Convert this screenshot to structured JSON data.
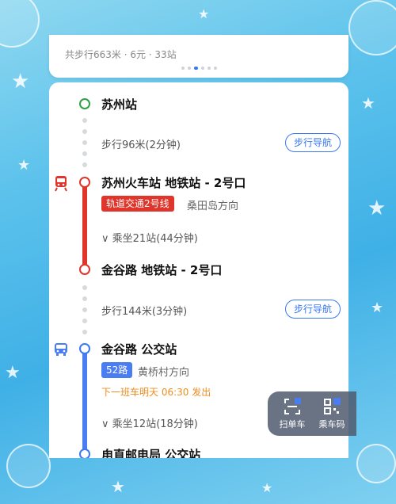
{
  "summary": {
    "text": "共步行663米 · 6元 · 33站"
  },
  "pager": {
    "count": 6,
    "active": 2
  },
  "route": {
    "start_station": "苏州站",
    "walk1": {
      "text": "步行96米(2分钟)",
      "button": "步行导航"
    },
    "metro": {
      "board_station": "苏州火车站 地铁站 - 2号口",
      "line_label": "轨道交通2号线",
      "direction": "桑田岛方向",
      "ride_info": "乘坐21站(44分钟)",
      "alight_station": "金谷路 地铁站 - 2号口",
      "color": "#e0352b"
    },
    "walk2": {
      "text": "步行144米(3分钟)",
      "button": "步行导航"
    },
    "bus": {
      "board_station": "金谷路 公交站",
      "line_label": "52路",
      "direction": "黄桥村方向",
      "next_bus": "下一班车明天 06:30 发出",
      "ride_info": "乘坐12站(18分钟)",
      "alight_station": "甪直邮电局 公交站",
      "color": "#4b7df2"
    }
  },
  "float_panel": {
    "scan_label": "扫单车",
    "code_label": "乘车码"
  },
  "colors": {
    "accent": "#3a78f2",
    "walk_green": "#2ea043",
    "next_bus_orange": "#f08c1e"
  }
}
